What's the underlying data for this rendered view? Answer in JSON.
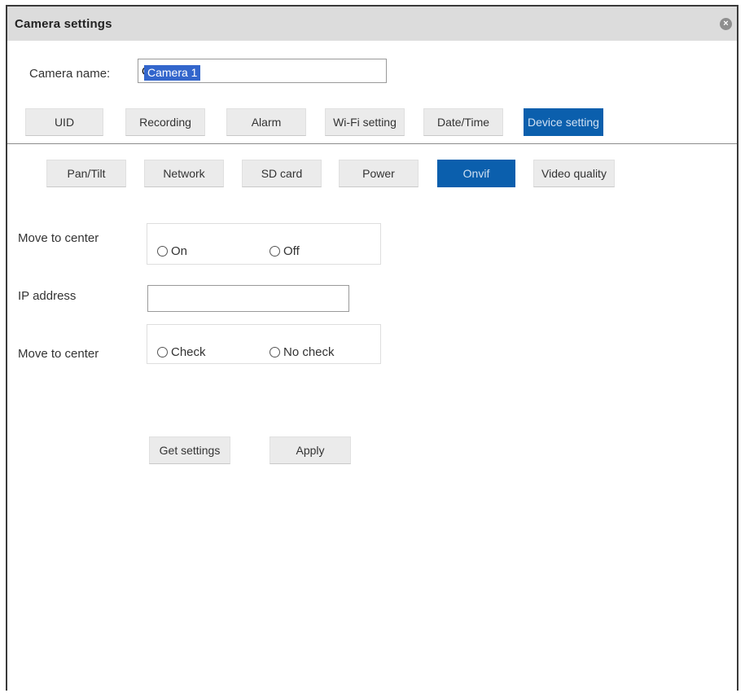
{
  "window": {
    "title": "Camera settings",
    "close_glyph": "×"
  },
  "camera_name": {
    "label": "Camera name:",
    "value": "Camera 1"
  },
  "main_tabs": [
    {
      "label": "UID",
      "active": false
    },
    {
      "label": "Recording",
      "active": false
    },
    {
      "label": "Alarm",
      "active": false
    },
    {
      "label": "Wi-Fi setting",
      "active": false
    },
    {
      "label": "Date/Time",
      "active": false
    },
    {
      "label": "Device setting",
      "active": true
    }
  ],
  "sub_tabs": [
    {
      "label": "Pan/Tilt",
      "active": false
    },
    {
      "label": "Network",
      "active": false
    },
    {
      "label": "SD card",
      "active": false
    },
    {
      "label": "Power",
      "active": false
    },
    {
      "label": "Onvif",
      "active": true
    },
    {
      "label": "Video quality",
      "active": false
    }
  ],
  "form": {
    "move_to_center_1": {
      "label": "Move to center",
      "options": [
        "On",
        "Off"
      ]
    },
    "ip_address": {
      "label": "IP address",
      "value": ""
    },
    "move_to_center_2": {
      "label": "Move to center",
      "options": [
        "Check",
        "No check"
      ]
    }
  },
  "buttons": {
    "get_settings": "Get settings",
    "apply": "Apply"
  },
  "colors": {
    "active_tab": "#0b5fad",
    "titlebar": "#dcdcdc",
    "selection": "#3366cc"
  }
}
